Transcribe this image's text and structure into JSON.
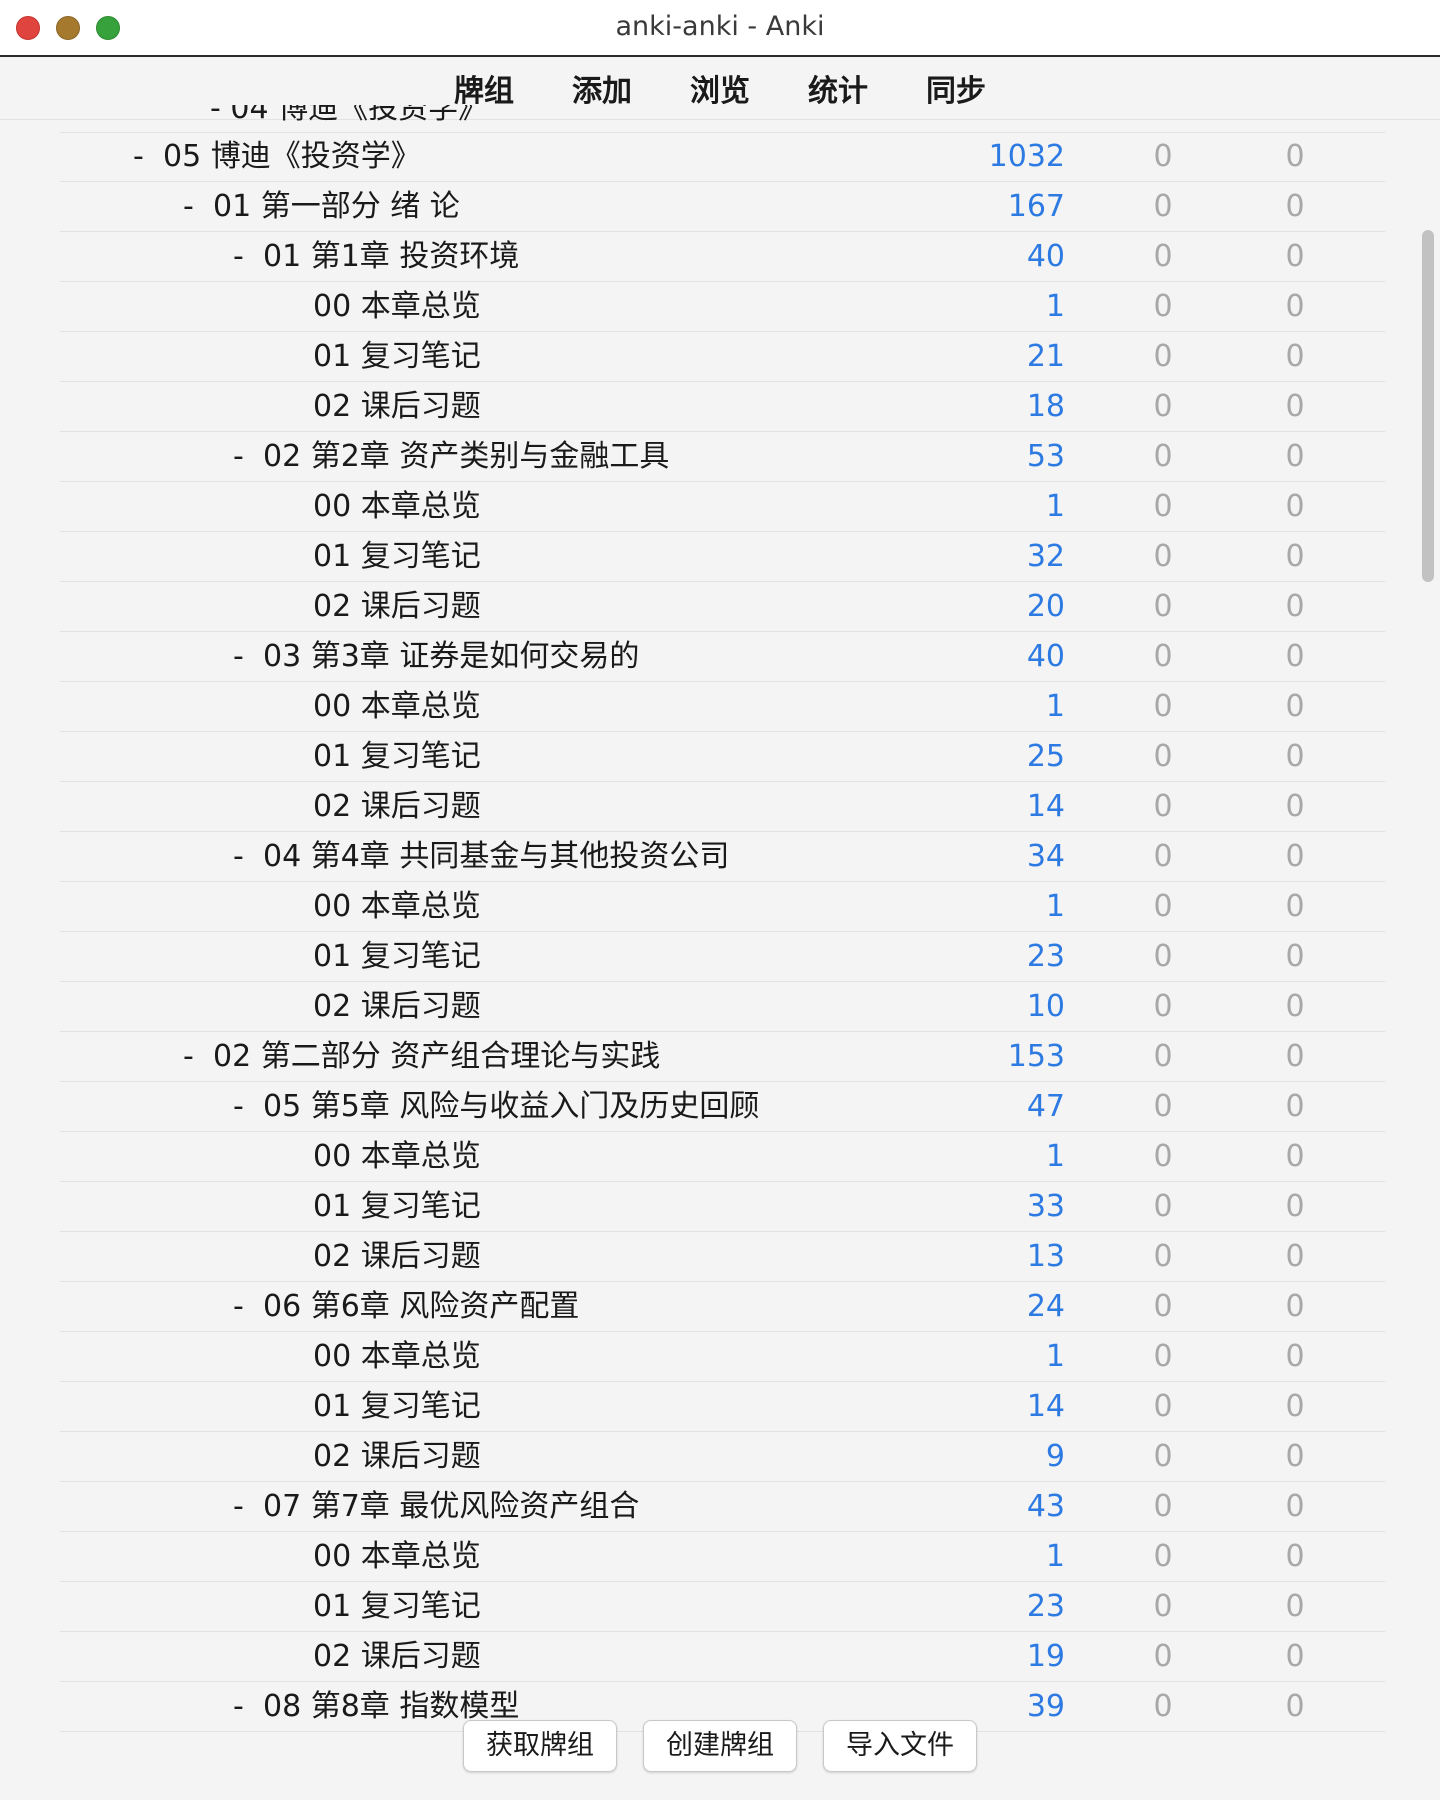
{
  "window": {
    "title": "anki-anki - Anki"
  },
  "nav": [
    "牌组",
    "添加",
    "浏览",
    "统计",
    "同步"
  ],
  "clipped_row_text": "- 04 博迪《投资学》",
  "decks": [
    {
      "level": 1,
      "collapse": "-",
      "name": "05 博迪《投资学》",
      "new": "1032",
      "learn": "0",
      "due": "0"
    },
    {
      "level": 2,
      "collapse": "-",
      "name": "01 第一部分 绪 论",
      "new": "167",
      "learn": "0",
      "due": "0"
    },
    {
      "level": 3,
      "collapse": "-",
      "name": "01 第1章 投资环境",
      "new": "40",
      "learn": "0",
      "due": "0"
    },
    {
      "level": 4,
      "collapse": "",
      "name": "00 本章总览",
      "new": "1",
      "learn": "0",
      "due": "0"
    },
    {
      "level": 4,
      "collapse": "",
      "name": "01 复习笔记",
      "new": "21",
      "learn": "0",
      "due": "0"
    },
    {
      "level": 4,
      "collapse": "",
      "name": "02 课后习题",
      "new": "18",
      "learn": "0",
      "due": "0"
    },
    {
      "level": 3,
      "collapse": "-",
      "name": "02 第2章 资产类别与金融工具",
      "new": "53",
      "learn": "0",
      "due": "0"
    },
    {
      "level": 4,
      "collapse": "",
      "name": "00 本章总览",
      "new": "1",
      "learn": "0",
      "due": "0"
    },
    {
      "level": 4,
      "collapse": "",
      "name": "01 复习笔记",
      "new": "32",
      "learn": "0",
      "due": "0"
    },
    {
      "level": 4,
      "collapse": "",
      "name": "02 课后习题",
      "new": "20",
      "learn": "0",
      "due": "0"
    },
    {
      "level": 3,
      "collapse": "-",
      "name": "03 第3章 证券是如何交易的",
      "new": "40",
      "learn": "0",
      "due": "0"
    },
    {
      "level": 4,
      "collapse": "",
      "name": "00 本章总览",
      "new": "1",
      "learn": "0",
      "due": "0"
    },
    {
      "level": 4,
      "collapse": "",
      "name": "01 复习笔记",
      "new": "25",
      "learn": "0",
      "due": "0"
    },
    {
      "level": 4,
      "collapse": "",
      "name": "02 课后习题",
      "new": "14",
      "learn": "0",
      "due": "0"
    },
    {
      "level": 3,
      "collapse": "-",
      "name": "04 第4章 共同基金与其他投资公司",
      "new": "34",
      "learn": "0",
      "due": "0"
    },
    {
      "level": 4,
      "collapse": "",
      "name": "00 本章总览",
      "new": "1",
      "learn": "0",
      "due": "0"
    },
    {
      "level": 4,
      "collapse": "",
      "name": "01 复习笔记",
      "new": "23",
      "learn": "0",
      "due": "0"
    },
    {
      "level": 4,
      "collapse": "",
      "name": "02 课后习题",
      "new": "10",
      "learn": "0",
      "due": "0"
    },
    {
      "level": 2,
      "collapse": "-",
      "name": "02 第二部分 资产组合理论与实践",
      "new": "153",
      "learn": "0",
      "due": "0"
    },
    {
      "level": 3,
      "collapse": "-",
      "name": "05 第5章 风险与收益入门及历史回顾",
      "new": "47",
      "learn": "0",
      "due": "0"
    },
    {
      "level": 4,
      "collapse": "",
      "name": "00 本章总览",
      "new": "1",
      "learn": "0",
      "due": "0"
    },
    {
      "level": 4,
      "collapse": "",
      "name": "01 复习笔记",
      "new": "33",
      "learn": "0",
      "due": "0"
    },
    {
      "level": 4,
      "collapse": "",
      "name": "02 课后习题",
      "new": "13",
      "learn": "0",
      "due": "0"
    },
    {
      "level": 3,
      "collapse": "-",
      "name": "06 第6章 风险资产配置",
      "new": "24",
      "learn": "0",
      "due": "0"
    },
    {
      "level": 4,
      "collapse": "",
      "name": "00 本章总览",
      "new": "1",
      "learn": "0",
      "due": "0"
    },
    {
      "level": 4,
      "collapse": "",
      "name": "01 复习笔记",
      "new": "14",
      "learn": "0",
      "due": "0"
    },
    {
      "level": 4,
      "collapse": "",
      "name": "02 课后习题",
      "new": "9",
      "learn": "0",
      "due": "0"
    },
    {
      "level": 3,
      "collapse": "-",
      "name": "07 第7章 最优风险资产组合",
      "new": "43",
      "learn": "0",
      "due": "0"
    },
    {
      "level": 4,
      "collapse": "",
      "name": "00 本章总览",
      "new": "1",
      "learn": "0",
      "due": "0"
    },
    {
      "level": 4,
      "collapse": "",
      "name": "01 复习笔记",
      "new": "23",
      "learn": "0",
      "due": "0"
    },
    {
      "level": 4,
      "collapse": "",
      "name": "02 课后习题",
      "new": "19",
      "learn": "0",
      "due": "0"
    },
    {
      "level": 3,
      "collapse": "-",
      "name": "08 第8章 指数模型",
      "new": "39",
      "learn": "0",
      "due": "0"
    }
  ],
  "footer": {
    "get_shared": "获取牌组",
    "create_deck": "创建牌组",
    "import_file": "导入文件"
  },
  "colors": {
    "new_count": "#2d7ae3",
    "zero_count": "#a8a8a8",
    "close": "#e0443e",
    "minimize": "#a5792e",
    "zoom": "#37a23b"
  }
}
